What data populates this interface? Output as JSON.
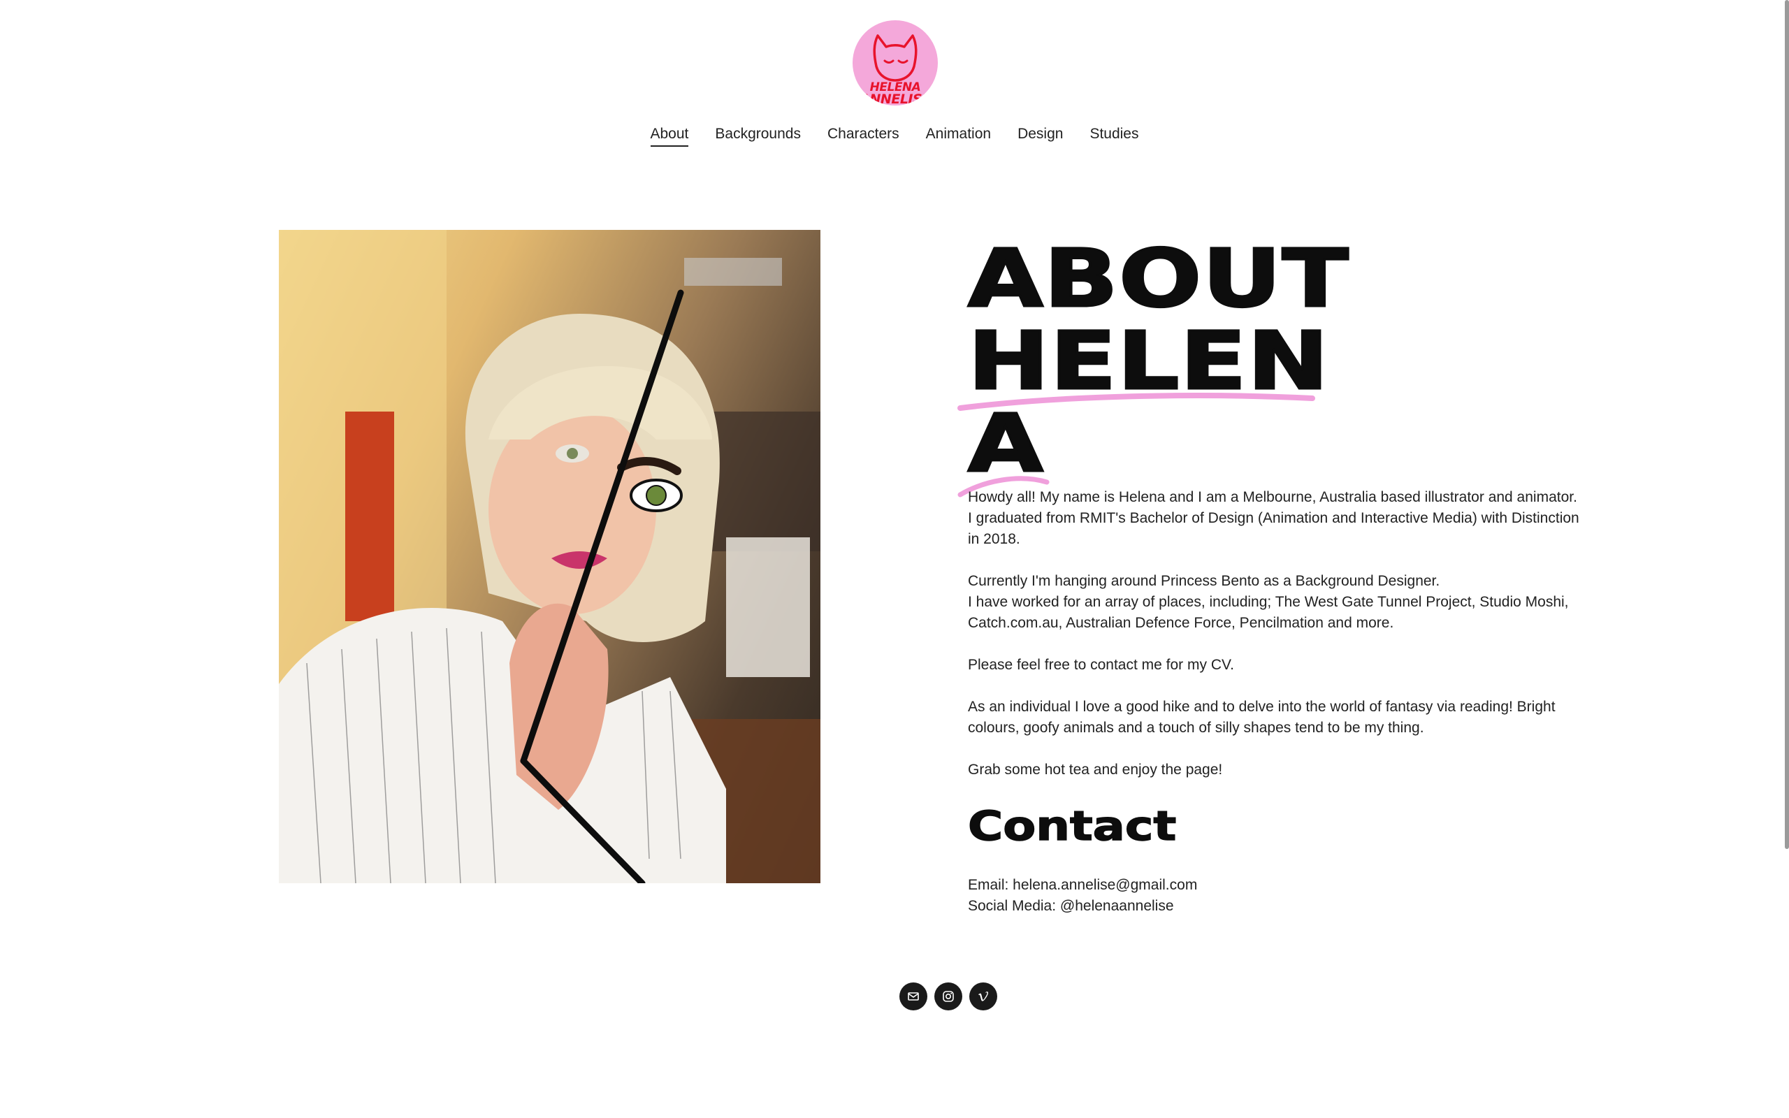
{
  "brand": {
    "logo_line1": "HELENA",
    "logo_line2": "ANNELISE",
    "logo_bg": "#f4a8da",
    "logo_fg": "#e8132c"
  },
  "nav": {
    "items": [
      {
        "label": "About",
        "active": true
      },
      {
        "label": "Backgrounds",
        "active": false
      },
      {
        "label": "Characters",
        "active": false
      },
      {
        "label": "Animation",
        "active": false
      },
      {
        "label": "Design",
        "active": false
      },
      {
        "label": "Studies",
        "active": false
      }
    ]
  },
  "about": {
    "title_lines": [
      "ABOUT",
      "HELEN",
      "A"
    ],
    "accent_color": "#f0a0dc",
    "paragraphs": [
      "Howdy all! My name is Helena and I am a Melbourne, Australia based illustrator and animator. I graduated from RMIT's Bachelor of Design (Animation and Interactive Media) with Distinction in 2018.",
      "Currently I'm hanging around Princess Bento as a Background Designer.\nI have worked for an array of places,  including; The West Gate Tunnel Project, Studio Moshi, Catch.com.au, Australian Defence Force, Pencilmation and more.",
      "Please feel free to contact me for my CV.",
      "As an individual I love a good hike and to delve into the world of fantasy via reading! Bright colours, goofy animals and a touch of silly shapes tend to be my thing.",
      "Grab some hot tea and enjoy the page!"
    ]
  },
  "contact": {
    "title": "Contact",
    "email_line": "Email: helena.annelise@gmail.com",
    "social_line": "Social Media: @helenaannelise"
  },
  "socials": [
    {
      "icon": "mail-icon"
    },
    {
      "icon": "instagram-icon"
    },
    {
      "icon": "vimeo-icon"
    }
  ]
}
